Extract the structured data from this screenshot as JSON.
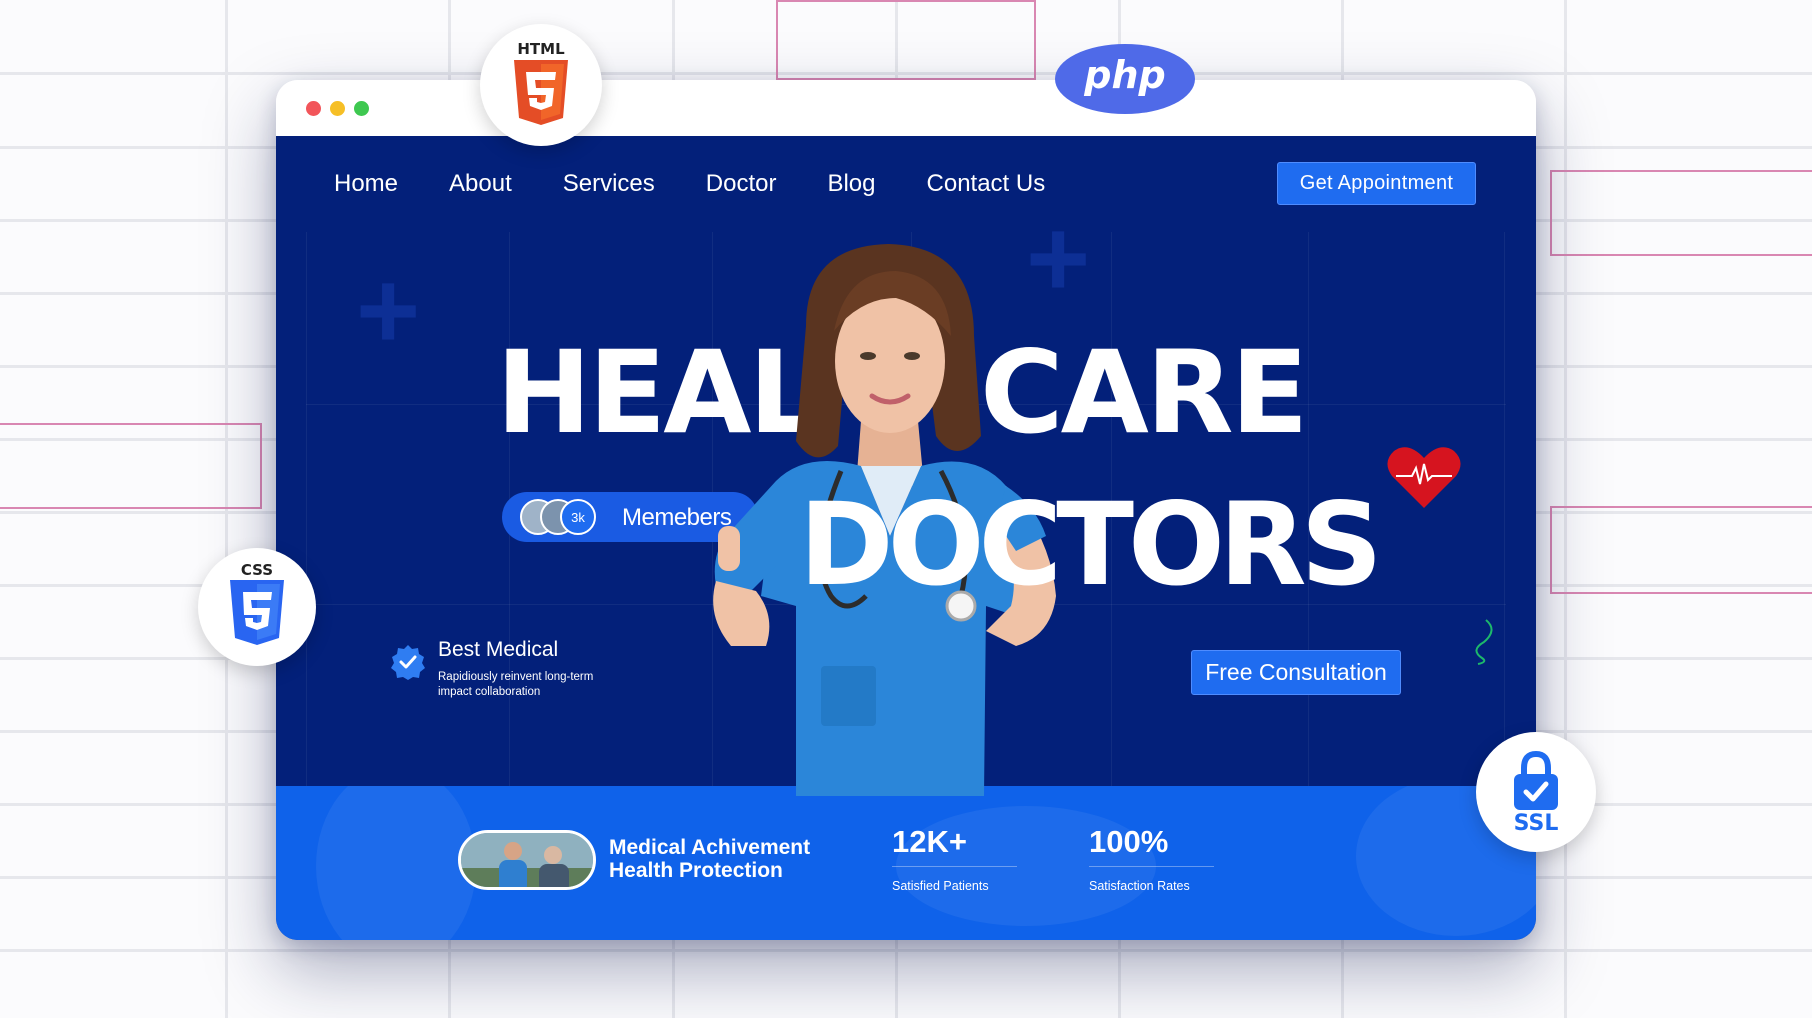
{
  "badges": {
    "html": "HTML",
    "php": "php",
    "css": "CSS",
    "ssl": "SSL"
  },
  "nav": {
    "items": [
      "Home",
      "About",
      "Services",
      "Doctor",
      "Blog",
      "Contact Us"
    ],
    "cta": "Get Appointment"
  },
  "hero": {
    "line1_part1": "HEAL",
    "line1_part2": "CARE",
    "line2": "DOCTORS",
    "members_count": "3k",
    "members_label": "Memebers",
    "best_title": "Best Medical",
    "best_desc": "Rapidiously reinvent long-term impact collaboration",
    "cta": "Free Consultation"
  },
  "stats": {
    "achievement_title": "Medical Achivement\nHealth Protection",
    "items": [
      {
        "value": "12K+",
        "label": "Satisfied Patients"
      },
      {
        "value": "100%",
        "label": "Satisfaction Rates"
      }
    ]
  },
  "colors": {
    "site_bg": "#03207a",
    "accent_blue": "#1f6cf0",
    "stats_bg": "#0f62ea",
    "html_orange": "#e44d26",
    "css_blue": "#2965f1",
    "php_blue": "#4f6ae8",
    "heart_red": "#d6141f"
  },
  "icons": [
    "html5-icon",
    "php-icon",
    "css3-icon",
    "ssl-lock-icon",
    "heart-pulse-icon",
    "verified-check-icon",
    "plus-icon"
  ]
}
